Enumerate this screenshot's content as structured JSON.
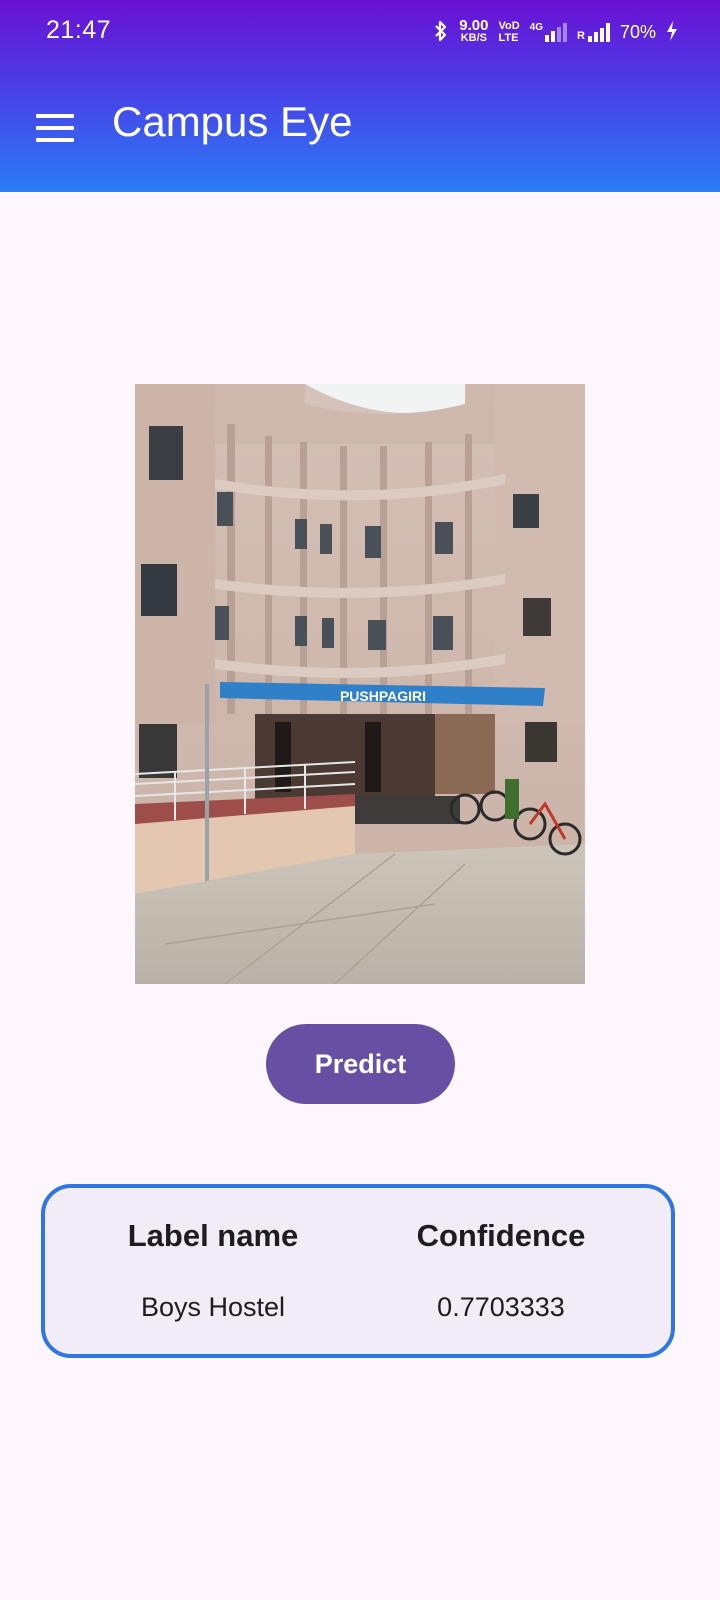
{
  "status_bar": {
    "time": "21:47",
    "net_speed_value": "9.00",
    "net_speed_unit": "KB/S",
    "volte_top": "VoD",
    "volte_bottom": "LTE",
    "network_type": "4G",
    "roaming": "R",
    "battery": "70%",
    "icons": [
      "bluetooth-icon",
      "signal-icon",
      "charging-icon"
    ]
  },
  "app_bar": {
    "title": "Campus Eye",
    "menu_icon": "hamburger-menu-icon"
  },
  "photo": {
    "sign_text": "PUSHPAGIRI"
  },
  "predict_button": "Predict",
  "results": {
    "headers": [
      "Label name",
      "Confidence"
    ],
    "label": "Boys Hostel",
    "confidence": "0.7703333"
  },
  "colors": {
    "header_top": "#6a11d3",
    "header_bottom": "#2b7cf5",
    "button": "#6750a4",
    "card_border": "#2e76e6",
    "card_bg": "#f1ecf6",
    "page_bg": "#fdf6fd"
  }
}
